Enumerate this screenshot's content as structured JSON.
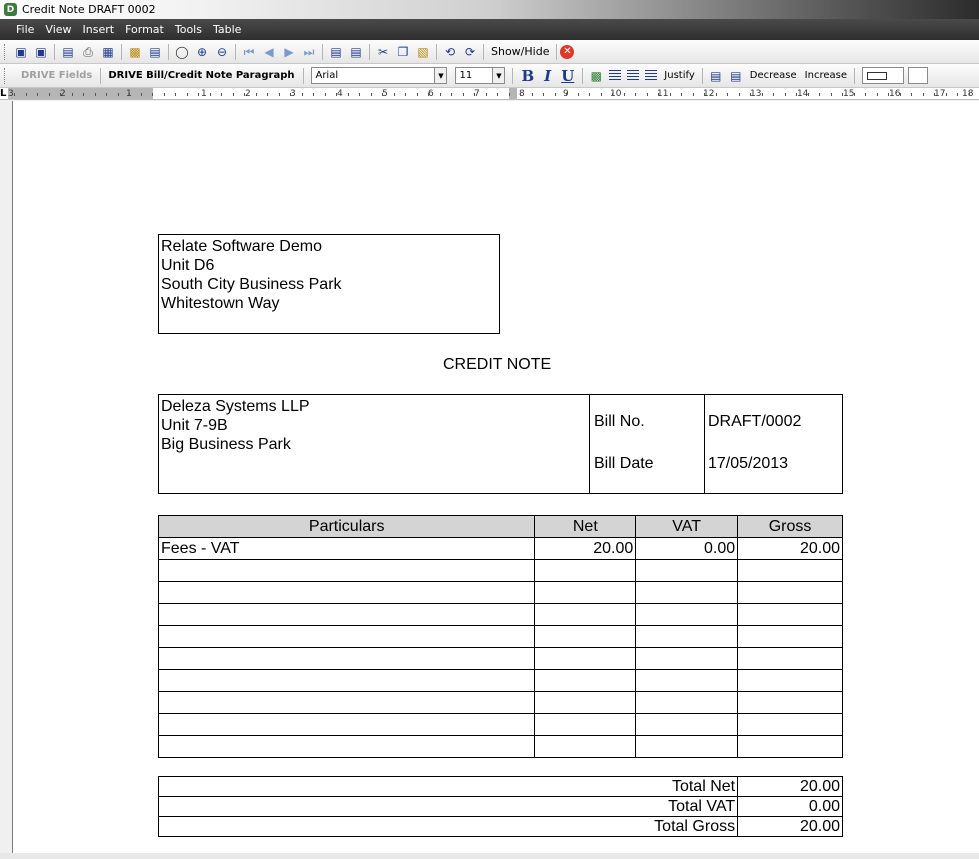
{
  "window": {
    "title": "Credit Note DRAFT 0002",
    "app_icon_letter": "D"
  },
  "menu": [
    {
      "label": "File"
    },
    {
      "label": "View"
    },
    {
      "label": "Insert"
    },
    {
      "label": "Format"
    },
    {
      "label": "Tools"
    },
    {
      "label": "Table"
    }
  ],
  "toolbar1": {
    "show_hide_label": "Show/Hide"
  },
  "toolbar2": {
    "drive_fields_label": "DRIVE Fields",
    "paragraph_style": "DRIVE Bill/Credit Note Paragraph",
    "font_name": "Arial",
    "font_size": "11",
    "bold_label": "B",
    "italic_label": "I",
    "underline_label": "U",
    "justify_label": "Justify",
    "decrease_label": "Decrease",
    "increase_label": "Increase"
  },
  "ruler": {
    "numbers": [
      "3",
      "2",
      "1",
      "1",
      "2",
      "3",
      "4",
      "5",
      "6",
      "7",
      "8",
      "9",
      "10",
      "11",
      "12",
      "13",
      "14",
      "15",
      "16",
      "17",
      "18"
    ]
  },
  "document": {
    "from_address": [
      "Relate Software Demo",
      "Unit D6",
      "South City Business Park",
      "Whitestown Way"
    ],
    "title": "CREDIT NOTE",
    "to_address": [
      "Deleza Systems LLP",
      "Unit 7-9B",
      "Big Business Park"
    ],
    "bill_no_label": "Bill No.",
    "bill_no_value": "DRAFT/0002",
    "bill_date_label": "Bill Date",
    "bill_date_value": "17/05/2013",
    "table": {
      "headers": [
        "Particulars",
        "Net",
        "VAT",
        "Gross"
      ],
      "rows": [
        [
          "Fees - VAT",
          "20.00",
          "0.00",
          "20.00"
        ],
        [
          "",
          "",
          "",
          ""
        ],
        [
          "",
          "",
          "",
          ""
        ],
        [
          "",
          "",
          "",
          ""
        ],
        [
          "",
          "",
          "",
          ""
        ],
        [
          "",
          "",
          "",
          ""
        ],
        [
          "",
          "",
          "",
          ""
        ],
        [
          "",
          "",
          "",
          ""
        ],
        [
          "",
          "",
          "",
          ""
        ],
        [
          "",
          "",
          "",
          ""
        ]
      ]
    },
    "totals": [
      {
        "label": "Total Net",
        "value": "20.00"
      },
      {
        "label": "Total VAT",
        "value": "0.00"
      },
      {
        "label": "Total Gross",
        "value": "20.00"
      }
    ]
  }
}
